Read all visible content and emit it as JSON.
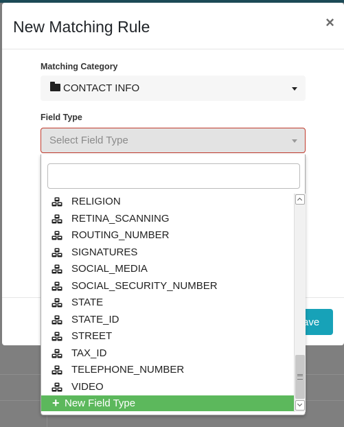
{
  "modal": {
    "title": "New Matching Rule",
    "close_glyph": "×",
    "save_label": "Save"
  },
  "form": {
    "category_label": "Matching Category",
    "category_value": "CONTACT INFO",
    "field_type_label": "Field Type",
    "field_type_placeholder": "Select Field Type"
  },
  "dropdown": {
    "search_value": "",
    "items": [
      "RELIGION",
      "RETINA_SCANNING",
      "ROUTING_NUMBER",
      "SIGNATURES",
      "SOCIAL_MEDIA",
      "SOCIAL_SECURITY_NUMBER",
      "STATE",
      "STATE_ID",
      "STREET",
      "TAX_ID",
      "TELEPHONE_NUMBER",
      "VIDEO"
    ],
    "new_item_label": "New Field Type",
    "item_icon": "cubes-icon"
  },
  "colors": {
    "save_button": "#17a2b8",
    "new_item_bg": "#5cb85c",
    "error_border": "#c0392b"
  }
}
